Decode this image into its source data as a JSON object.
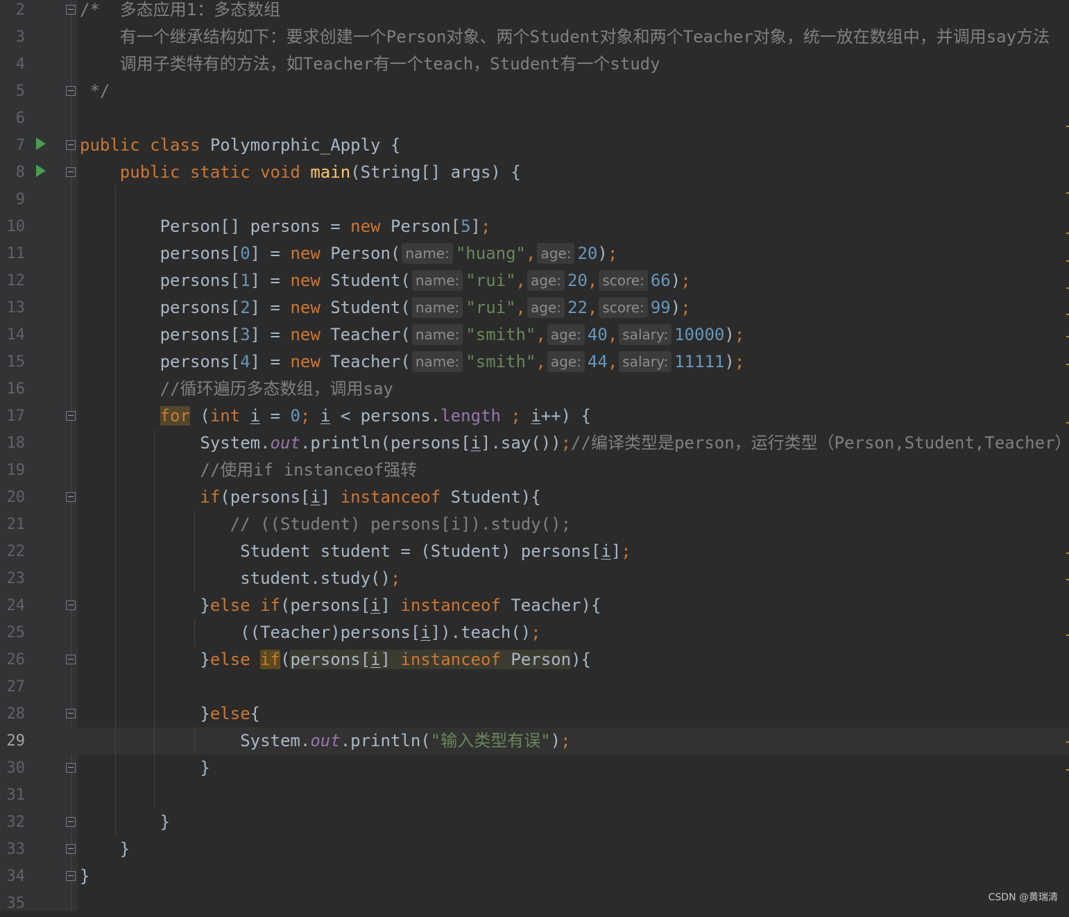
{
  "lines": [
    {
      "n": "2",
      "segs": [
        {
          "t": "/*  ",
          "c": "cm"
        },
        {
          "t": "多态应用1：多态数组",
          "c": "cm cmt-cn"
        }
      ]
    },
    {
      "n": "3",
      "segs": [
        {
          "t": "    有一个继承结构如下：要求创建一个Person对象、两个Student对象和两个Teacher对象，统一放在数组中，并调用say方法",
          "c": "cm"
        }
      ]
    },
    {
      "n": "4",
      "segs": [
        {
          "t": "    调用子类特有的方法，如Teacher有一个teach，Student有一个study",
          "c": "cm"
        }
      ]
    },
    {
      "n": "5",
      "segs": [
        {
          "t": " */",
          "c": "cm"
        }
      ]
    },
    {
      "n": "6",
      "segs": []
    },
    {
      "n": "7",
      "segs": [
        {
          "t": "public class ",
          "c": "kw"
        },
        {
          "t": "Polymorphic_Apply {"
        }
      ]
    },
    {
      "n": "8",
      "segs": [
        {
          "t": "    "
        },
        {
          "t": "public static void ",
          "c": "kw"
        },
        {
          "t": "main",
          "c": "fn"
        },
        {
          "t": "(String[] args) {"
        }
      ]
    },
    {
      "n": "9",
      "segs": []
    },
    {
      "n": "10",
      "segs": [
        {
          "t": "        Person[] persons = "
        },
        {
          "t": "new ",
          "c": "kw"
        },
        {
          "t": "Person["
        },
        {
          "t": "5",
          "c": "num"
        },
        {
          "t": "]"
        },
        {
          "t": ";",
          "c": "kw"
        }
      ]
    },
    {
      "n": "11",
      "segs": [
        {
          "t": "        persons["
        },
        {
          "t": "0",
          "c": "num"
        },
        {
          "t": "] = "
        },
        {
          "t": "new ",
          "c": "kw"
        },
        {
          "t": "Person("
        },
        {
          "t": "name:",
          "c": "hint"
        },
        {
          "t": "\"huang\"",
          "c": "str"
        },
        {
          "t": ",",
          "c": "kw"
        },
        {
          "t": "age:",
          "c": "hint"
        },
        {
          "t": "20",
          "c": "num"
        },
        {
          "t": ")"
        },
        {
          "t": ";",
          "c": "kw"
        }
      ]
    },
    {
      "n": "12",
      "segs": [
        {
          "t": "        persons["
        },
        {
          "t": "1",
          "c": "num"
        },
        {
          "t": "] = "
        },
        {
          "t": "new ",
          "c": "kw"
        },
        {
          "t": "Student("
        },
        {
          "t": "name:",
          "c": "hint"
        },
        {
          "t": "\"rui\"",
          "c": "str"
        },
        {
          "t": ",",
          "c": "kw"
        },
        {
          "t": "age:",
          "c": "hint"
        },
        {
          "t": "20",
          "c": "num"
        },
        {
          "t": ",",
          "c": "kw"
        },
        {
          "t": "score:",
          "c": "hint"
        },
        {
          "t": "66",
          "c": "num"
        },
        {
          "t": ")"
        },
        {
          "t": ";",
          "c": "kw"
        }
      ]
    },
    {
      "n": "13",
      "segs": [
        {
          "t": "        persons["
        },
        {
          "t": "2",
          "c": "num"
        },
        {
          "t": "] = "
        },
        {
          "t": "new ",
          "c": "kw"
        },
        {
          "t": "Student("
        },
        {
          "t": "name:",
          "c": "hint"
        },
        {
          "t": "\"rui\"",
          "c": "str"
        },
        {
          "t": ",",
          "c": "kw"
        },
        {
          "t": "age:",
          "c": "hint"
        },
        {
          "t": "22",
          "c": "num"
        },
        {
          "t": ",",
          "c": "kw"
        },
        {
          "t": "score:",
          "c": "hint"
        },
        {
          "t": "99",
          "c": "num"
        },
        {
          "t": ")"
        },
        {
          "t": ";",
          "c": "kw"
        }
      ]
    },
    {
      "n": "14",
      "segs": [
        {
          "t": "        persons["
        },
        {
          "t": "3",
          "c": "num"
        },
        {
          "t": "] = "
        },
        {
          "t": "new ",
          "c": "kw"
        },
        {
          "t": "Teacher("
        },
        {
          "t": "name:",
          "c": "hint"
        },
        {
          "t": "\"smith\"",
          "c": "str"
        },
        {
          "t": ",",
          "c": "kw"
        },
        {
          "t": "age:",
          "c": "hint"
        },
        {
          "t": "40",
          "c": "num"
        },
        {
          "t": ",",
          "c": "kw"
        },
        {
          "t": "salary:",
          "c": "hint"
        },
        {
          "t": "10000",
          "c": "num"
        },
        {
          "t": ")"
        },
        {
          "t": ";",
          "c": "kw"
        }
      ]
    },
    {
      "n": "15",
      "segs": [
        {
          "t": "        persons["
        },
        {
          "t": "4",
          "c": "num"
        },
        {
          "t": "] = "
        },
        {
          "t": "new ",
          "c": "kw"
        },
        {
          "t": "Teacher("
        },
        {
          "t": "name:",
          "c": "hint"
        },
        {
          "t": "\"smith\"",
          "c": "str"
        },
        {
          "t": ",",
          "c": "kw"
        },
        {
          "t": "age:",
          "c": "hint"
        },
        {
          "t": "44",
          "c": "num"
        },
        {
          "t": ",",
          "c": "kw"
        },
        {
          "t": "salary:",
          "c": "hint"
        },
        {
          "t": "11111",
          "c": "num"
        },
        {
          "t": ")"
        },
        {
          "t": ";",
          "c": "kw"
        }
      ]
    },
    {
      "n": "16",
      "segs": [
        {
          "t": "        //循环遍历多态数组，调用say",
          "c": "cm"
        }
      ]
    },
    {
      "n": "17",
      "segs": [
        {
          "t": "        "
        },
        {
          "t": "for",
          "c": "kw hl-for"
        },
        {
          "t": " ("
        },
        {
          "t": "int ",
          "c": "kw"
        },
        {
          "t": "i",
          "c": "und"
        },
        {
          "t": " = "
        },
        {
          "t": "0",
          "c": "num"
        },
        {
          "t": "; ",
          "c": "kw"
        },
        {
          "t": "i",
          "c": "und"
        },
        {
          "t": " < persons."
        },
        {
          "t": "length",
          "c": "fld"
        },
        {
          "t": " ; ",
          "c": "kw"
        },
        {
          "t": "i",
          "c": "und"
        },
        {
          "t": "++) {"
        }
      ]
    },
    {
      "n": "18",
      "segs": [
        {
          "t": "            System."
        },
        {
          "t": "out",
          "c": "ital"
        },
        {
          "t": ".println(persons["
        },
        {
          "t": "i",
          "c": "und"
        },
        {
          "t": "].say())"
        },
        {
          "t": ";",
          "c": "kw"
        },
        {
          "t": "//编译类型是person，运行类型（Person,Student,Teacher）",
          "c": "cm"
        }
      ]
    },
    {
      "n": "19",
      "segs": [
        {
          "t": "            //使用if instanceof强转",
          "c": "cm"
        }
      ]
    },
    {
      "n": "20",
      "segs": [
        {
          "t": "            "
        },
        {
          "t": "if",
          "c": "kw"
        },
        {
          "t": "(persons["
        },
        {
          "t": "i",
          "c": "und"
        },
        {
          "t": "] "
        },
        {
          "t": "instanceof ",
          "c": "kw"
        },
        {
          "t": "Student){"
        }
      ]
    },
    {
      "n": "21",
      "segs": [
        {
          "t": "               // ((Student) persons[i]).study();",
          "c": "cm"
        }
      ]
    },
    {
      "n": "22",
      "segs": [
        {
          "t": "                Student student = (Student) persons["
        },
        {
          "t": "i",
          "c": "und"
        },
        {
          "t": "]"
        },
        {
          "t": ";",
          "c": "kw"
        }
      ]
    },
    {
      "n": "23",
      "segs": [
        {
          "t": "                student.study()"
        },
        {
          "t": ";",
          "c": "kw"
        }
      ]
    },
    {
      "n": "24",
      "segs": [
        {
          "t": "            }"
        },
        {
          "t": "else if",
          "c": "kw"
        },
        {
          "t": "(persons["
        },
        {
          "t": "i",
          "c": "und"
        },
        {
          "t": "] "
        },
        {
          "t": "instanceof ",
          "c": "kw"
        },
        {
          "t": "Teacher){"
        }
      ]
    },
    {
      "n": "25",
      "segs": [
        {
          "t": "                ((Teacher)persons["
        },
        {
          "t": "i",
          "c": "und"
        },
        {
          "t": "]).teach()"
        },
        {
          "t": ";",
          "c": "kw"
        }
      ]
    },
    {
      "n": "26",
      "segs": [
        {
          "t": "            }"
        },
        {
          "t": "else ",
          "c": "kw"
        },
        {
          "t": "if",
          "c": "kw hl-kw"
        },
        {
          "t": "("
        },
        {
          "t": "persons[",
          "c": "hl-bg"
        },
        {
          "t": "i",
          "c": "und hl-bg"
        },
        {
          "t": "] ",
          "c": "hl-bg"
        },
        {
          "t": "instanceof ",
          "c": "kw hl-bg"
        },
        {
          "t": "Person",
          "c": "hl-bg"
        },
        {
          "t": "){"
        }
      ]
    },
    {
      "n": "27",
      "segs": []
    },
    {
      "n": "28",
      "segs": [
        {
          "t": "            }"
        },
        {
          "t": "else",
          "c": "kw"
        },
        {
          "t": "{"
        }
      ]
    },
    {
      "n": "29",
      "segs": [
        {
          "t": "                System."
        },
        {
          "t": "out",
          "c": "ital"
        },
        {
          "t": ".println("
        },
        {
          "t": "\"输入类型有误\"",
          "c": "str"
        },
        {
          "t": ")"
        },
        {
          "t": ";",
          "c": "kw"
        }
      ]
    },
    {
      "n": "30",
      "segs": [
        {
          "t": "            }"
        }
      ]
    },
    {
      "n": "31",
      "segs": []
    },
    {
      "n": "32",
      "segs": [
        {
          "t": "        }"
        }
      ]
    },
    {
      "n": "33",
      "segs": [
        {
          "t": "    }"
        }
      ]
    },
    {
      "n": "34",
      "segs": [
        {
          "t": "}"
        }
      ]
    },
    {
      "n": "35",
      "segs": []
    }
  ],
  "current_line": "29",
  "run_icon": "run-gutter-icon",
  "fold_icon": "fold-marker-icon",
  "watermark": "CSDN @黄瑞清",
  "colors": {
    "background": "#2b2b2b",
    "gutter": "#313335",
    "keyword": "#cc7832",
    "string": "#6a8759",
    "number": "#6897bb",
    "comment": "#808080",
    "method": "#ffc66d",
    "field": "#9876aa",
    "run": "#499c54"
  }
}
